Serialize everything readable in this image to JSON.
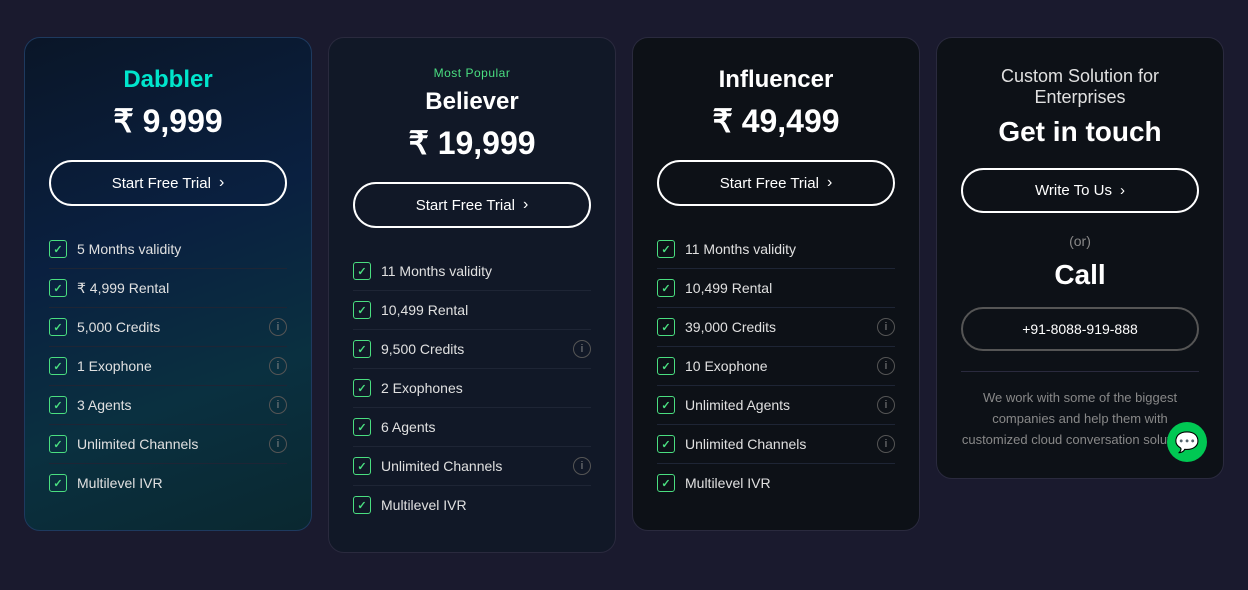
{
  "plans": [
    {
      "id": "dabbler",
      "badge": "",
      "name": "Dabbler",
      "price": "₹ 9,999",
      "cta": "Start Free Trial",
      "features": [
        {
          "label": "5 Months validity",
          "hasInfo": false
        },
        {
          "label": "₹ 4,999 Rental",
          "hasInfo": false
        },
        {
          "label": "5,000 Credits",
          "hasInfo": true
        },
        {
          "label": "1 Exophone",
          "hasInfo": true
        },
        {
          "label": "3 Agents",
          "hasInfo": true
        },
        {
          "label": "Unlimited Channels",
          "hasInfo": true
        },
        {
          "label": "Multilevel IVR",
          "hasInfo": false
        }
      ]
    },
    {
      "id": "believer",
      "badge": "Most Popular",
      "name": "Believer",
      "price": "₹ 19,999",
      "cta": "Start Free Trial",
      "features": [
        {
          "label": "11 Months validity",
          "hasInfo": false
        },
        {
          "label": "10,499 Rental",
          "hasInfo": false
        },
        {
          "label": "9,500 Credits",
          "hasInfo": true
        },
        {
          "label": "2 Exophones",
          "hasInfo": false
        },
        {
          "label": "6 Agents",
          "hasInfo": false
        },
        {
          "label": "Unlimited Channels",
          "hasInfo": true
        },
        {
          "label": "Multilevel IVR",
          "hasInfo": false
        }
      ]
    },
    {
      "id": "influencer",
      "badge": "",
      "name": "Influencer",
      "price": "₹ 49,499",
      "cta": "Start Free Trial",
      "features": [
        {
          "label": "11 Months validity",
          "hasInfo": false
        },
        {
          "label": "10,499 Rental",
          "hasInfo": false
        },
        {
          "label": "39,000 Credits",
          "hasInfo": true
        },
        {
          "label": "10 Exophone",
          "hasInfo": true
        },
        {
          "label": "Unlimited Agents",
          "hasInfo": true
        },
        {
          "label": "Unlimited Channels",
          "hasInfo": true
        },
        {
          "label": "Multilevel IVR",
          "hasInfo": false
        }
      ]
    }
  ],
  "enterprise": {
    "title": "Custom Solution for Enterprises",
    "subtitle": "Get in touch",
    "cta_write": "Write To Us",
    "or_text": "(or)",
    "call_label": "Call",
    "phone": "+91-8088-919-888",
    "description": "We work with some of the biggest companies and help them with customized cloud conversation solutions."
  }
}
